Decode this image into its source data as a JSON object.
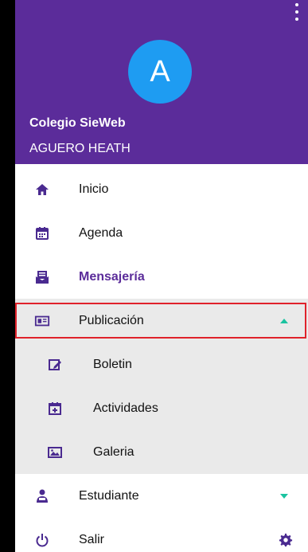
{
  "header": {
    "avatar_letter": "A",
    "school": "Colegio SieWeb",
    "user": "AGUERO HEATH"
  },
  "menu": [
    {
      "label": "Inicio",
      "icon": "home-icon"
    },
    {
      "label": "Agenda",
      "icon": "calendar-icon"
    },
    {
      "label": "Mensajería",
      "icon": "mail-icon"
    },
    {
      "label": "Publicación",
      "icon": "newspaper-icon"
    },
    {
      "label": "Boletin",
      "icon": "edit-icon"
    },
    {
      "label": "Actividades",
      "icon": "calendar-plus-icon"
    },
    {
      "label": "Galeria",
      "icon": "image-icon"
    },
    {
      "label": "Estudiante",
      "icon": "student-icon"
    },
    {
      "label": "Salir",
      "icon": "power-icon"
    }
  ],
  "colors": {
    "header": "#5b2c9a",
    "avatar": "#1e9cf2",
    "accent": "#1bc3a0",
    "highlight": "#e0222b"
  }
}
